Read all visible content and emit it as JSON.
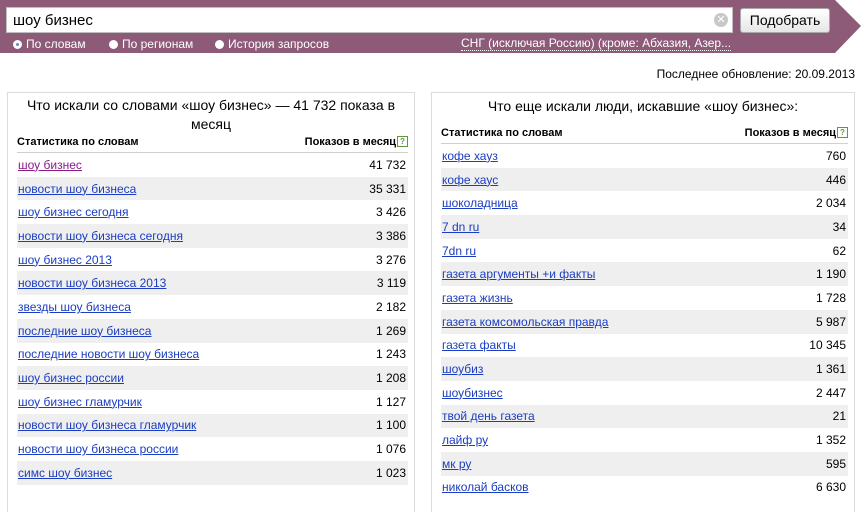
{
  "search": {
    "query": "шоу бизнес",
    "button_label": "Подобрать",
    "clear_icon": "close-icon"
  },
  "modes": [
    {
      "label": "По словам",
      "selected": true
    },
    {
      "label": "По регионам",
      "selected": false
    },
    {
      "label": "История запросов",
      "selected": false
    }
  ],
  "region": "СНГ (исключая Россию) (кроме: Абхазия, Азер...",
  "last_update": "Последнее обновление: 20.09.2013",
  "left_panel": {
    "title": "Что искали со словами «шоу бизнес» — 41 732 показа в месяц",
    "col_word": "Статистика по словам",
    "col_count": "Показов в месяц",
    "rows": [
      {
        "phrase": "шоу бизнес",
        "count": "41 732",
        "visited": true
      },
      {
        "phrase": "новости шоу бизнеса",
        "count": "35 331"
      },
      {
        "phrase": "шоу бизнес сегодня",
        "count": "3 426"
      },
      {
        "phrase": "новости шоу бизнеса сегодня",
        "count": "3 386"
      },
      {
        "phrase": "шоу бизнес 2013",
        "count": "3 276"
      },
      {
        "phrase": "новости шоу бизнеса 2013",
        "count": "3 119"
      },
      {
        "phrase": "звезды шоу бизнеса",
        "count": "2 182"
      },
      {
        "phrase": "последние шоу бизнеса",
        "count": "1 269"
      },
      {
        "phrase": "последние новости шоу бизнеса",
        "count": "1 243"
      },
      {
        "phrase": "шоу бизнес россии",
        "count": "1 208"
      },
      {
        "phrase": "шоу бизнес гламурчик",
        "count": "1 127"
      },
      {
        "phrase": "новости шоу бизнеса гламурчик",
        "count": "1 100"
      },
      {
        "phrase": "новости шоу бизнеса россии",
        "count": "1 076"
      },
      {
        "phrase": "симс шоу бизнес",
        "count": "1 023"
      }
    ]
  },
  "right_panel": {
    "title": "Что еще искали люди, искавшие «шоу бизнес»:",
    "col_word": "Статистика по словам",
    "col_count": "Показов в месяц",
    "rows": [
      {
        "phrase": "кофе хауз",
        "count": "760"
      },
      {
        "phrase": "кофе хаус",
        "count": "446"
      },
      {
        "phrase": "шоколадница",
        "count": "2 034"
      },
      {
        "phrase": "7 dn ru",
        "count": "34"
      },
      {
        "phrase": "7dn ru",
        "count": "62"
      },
      {
        "phrase": "газета аргументы +и факты",
        "count": "1 190"
      },
      {
        "phrase": "газета жизнь",
        "count": "1 728"
      },
      {
        "phrase": "газета комсомольская правда",
        "count": "5 987"
      },
      {
        "phrase": "газета факты",
        "count": "10 345"
      },
      {
        "phrase": "шоубиз",
        "count": "1 361"
      },
      {
        "phrase": "шоубизнес",
        "count": "2 447"
      },
      {
        "phrase": "твой день газета",
        "count": "21"
      },
      {
        "phrase": "лайф ру",
        "count": "1 352"
      },
      {
        "phrase": "мк ру",
        "count": "595"
      },
      {
        "phrase": "николай басков",
        "count": "6 630"
      }
    ]
  },
  "colors": {
    "header_bg": "#8d5a78",
    "link": "#1a3dc1",
    "visited_link": "#8b1a8b",
    "row_stripe": "#efefef"
  }
}
